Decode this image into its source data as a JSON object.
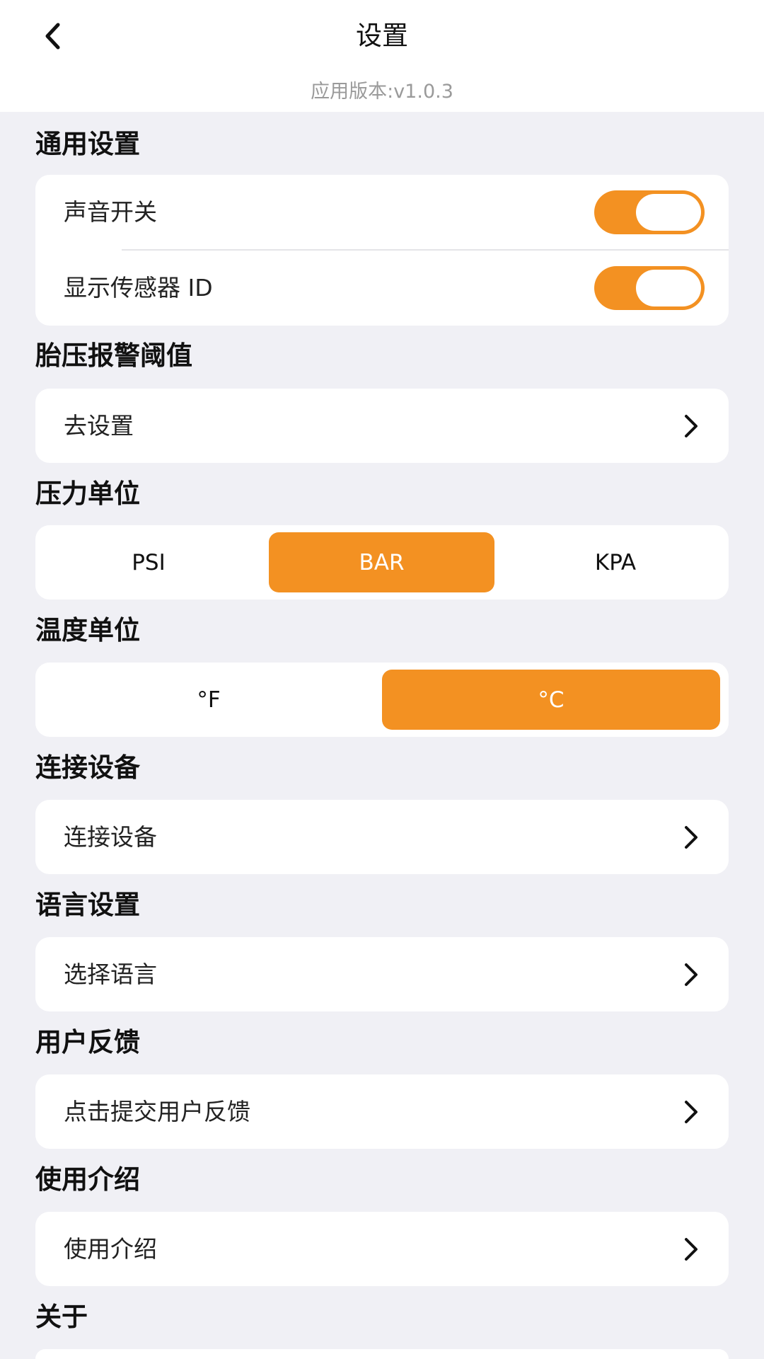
{
  "header": {
    "title": "设置",
    "version": "应用版本:v1.0.3"
  },
  "accent_color": "#f39122",
  "sections": {
    "general": {
      "title": "通用设置",
      "sound_label": "声音开关",
      "sound_on": true,
      "sensor_label": "显示传感器 ID",
      "sensor_on": true
    },
    "alarm": {
      "title": "胎压报警阈值",
      "row_label": "去设置"
    },
    "pressure": {
      "title": "压力单位",
      "options": [
        "PSI",
        "BAR",
        "KPA"
      ],
      "selected": "BAR"
    },
    "temperature": {
      "title": "温度单位",
      "options": [
        "°F",
        "°C"
      ],
      "selected": "°C"
    },
    "device": {
      "title": "连接设备",
      "row_label": "连接设备"
    },
    "language": {
      "title": "语言设置",
      "row_label": "选择语言"
    },
    "feedback": {
      "title": "用户反馈",
      "row_label": "点击提交用户反馈"
    },
    "intro": {
      "title": "使用介绍",
      "row_label": "使用介绍"
    },
    "about": {
      "title": "关于"
    }
  },
  "icons": {
    "back": "chevron-left-icon",
    "row_arrow": "chevron-right-icon"
  }
}
